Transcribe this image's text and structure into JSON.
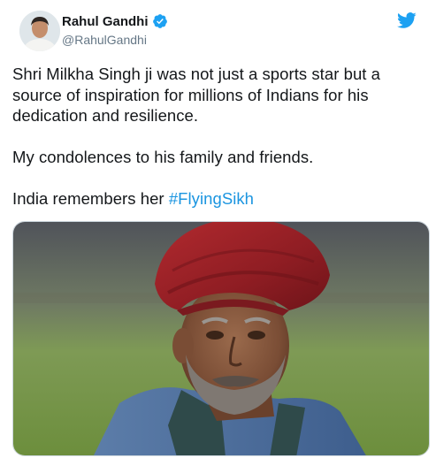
{
  "author": {
    "display_name": "Rahul Gandhi",
    "handle": "@RahulGandhi",
    "avatar_icon": "avatar-portrait-icon",
    "verified_icon": "verified-badge-icon"
  },
  "brand": {
    "logo_icon": "twitter-bird-icon",
    "accent_color": "#1da1f2",
    "link_color": "#1b95e0"
  },
  "tweet": {
    "paragraph_1": "Shri Milkha Singh ji was not just a sports star but a\nsource of inspiration for millions of Indians for his\ndedication and resilience.",
    "paragraph_2": "My condolences to his family and friends.",
    "paragraph_3_text": "India remembers her ",
    "paragraph_3_hashtag": "#FlyingSikh"
  },
  "media": {
    "type": "photo",
    "subject": "portrait-photo"
  }
}
